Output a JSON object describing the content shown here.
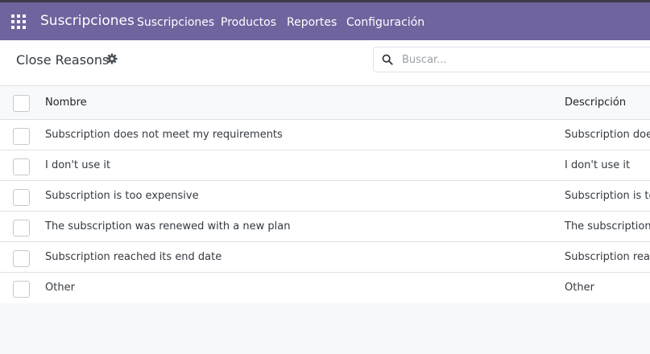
{
  "navbar": {
    "app_name": "Suscripciones",
    "menu": [
      {
        "label": "Suscripciones"
      },
      {
        "label": "Productos"
      },
      {
        "label": "Reportes"
      },
      {
        "label": "Configuración"
      }
    ]
  },
  "control_panel": {
    "title": "Close Reasons",
    "search_placeholder": "Buscar..."
  },
  "table": {
    "headers": {
      "name": "Nombre",
      "description": "Descripción"
    },
    "rows": [
      {
        "name": "Subscription does not meet my requirements",
        "description": "Subscription does"
      },
      {
        "name": "I don't use it",
        "description": "I don't use it"
      },
      {
        "name": "Subscription is too expensive",
        "description": "Subscription is to"
      },
      {
        "name": "The subscription was renewed with a new plan",
        "description": "The subscription"
      },
      {
        "name": "Subscription reached its end date",
        "description": "Subscription reac"
      },
      {
        "name": "Other",
        "description": "Other"
      }
    ]
  },
  "colors": {
    "navbar": "#71639e",
    "background": "#f7f8fa"
  },
  "icons": {
    "apps": "grid-apps-icon",
    "settings": "gear-icon",
    "search": "search-icon"
  }
}
